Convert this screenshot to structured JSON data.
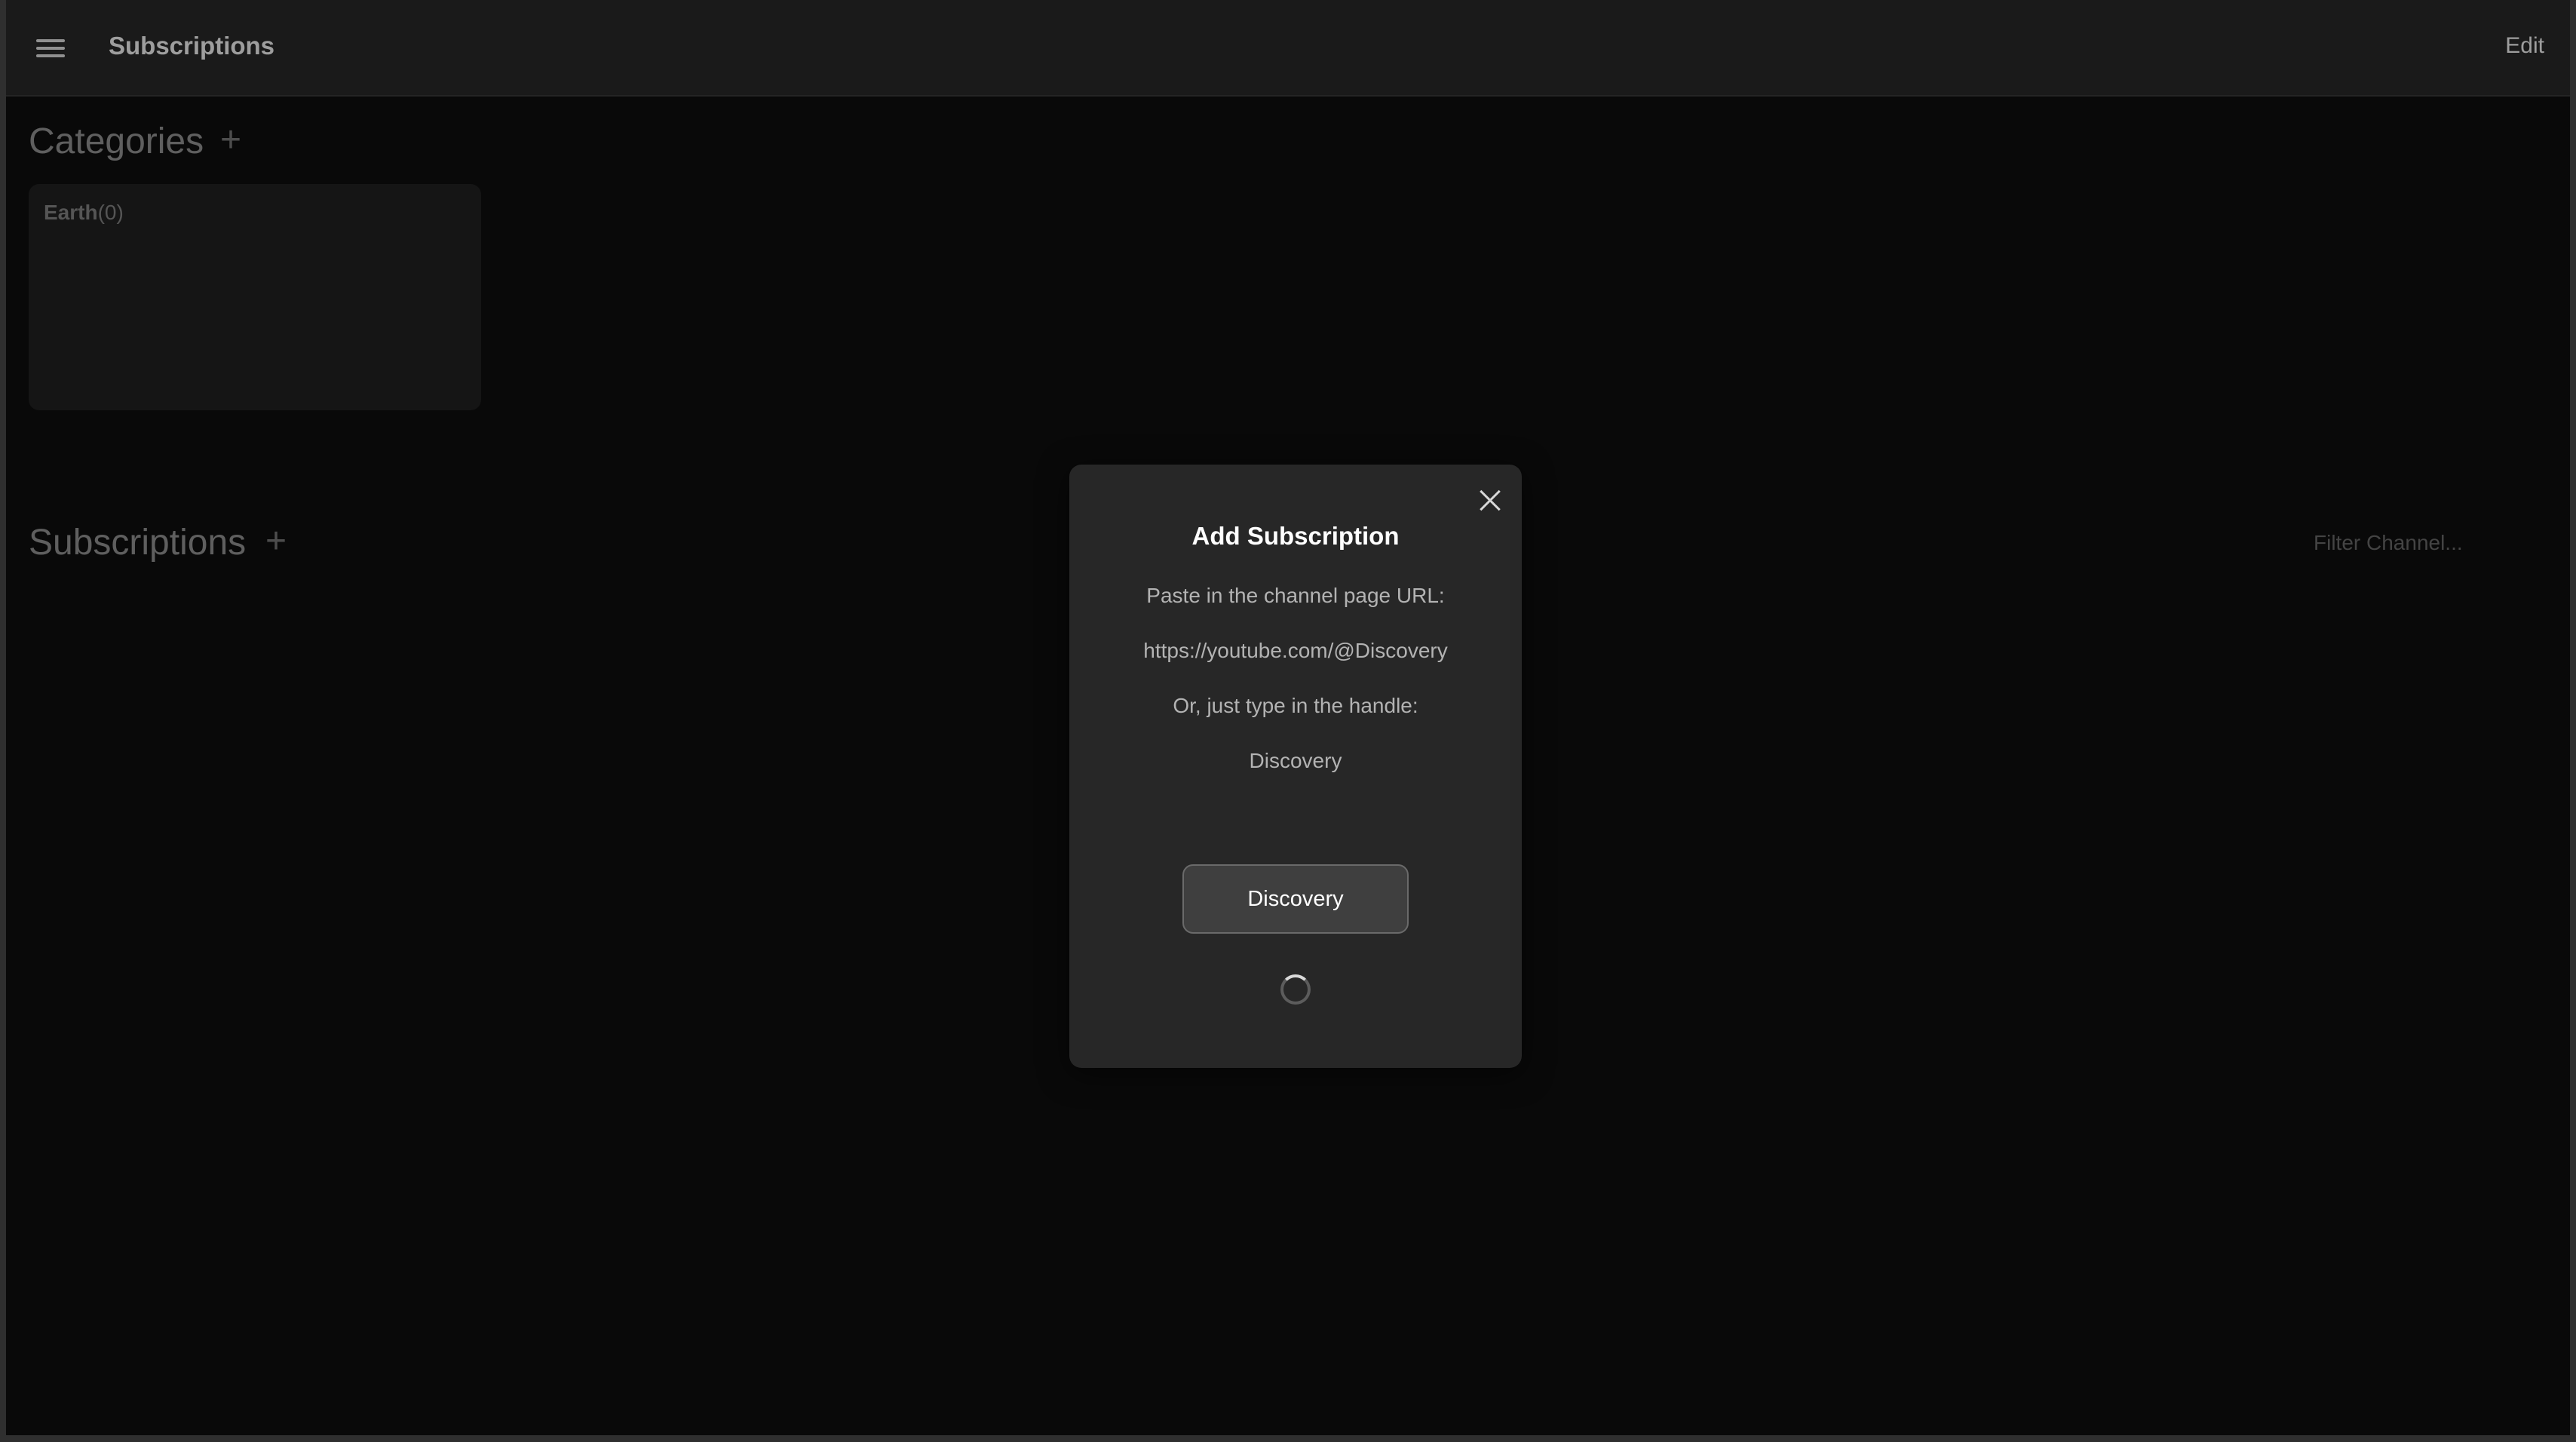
{
  "header": {
    "title": "Subscriptions",
    "edit_label": "Edit"
  },
  "categories": {
    "heading": "Categories",
    "add_symbol": "+",
    "items": [
      {
        "name": "Earth",
        "count": "(0)"
      }
    ]
  },
  "subscriptions": {
    "heading": "Subscriptions",
    "add_symbol": "+",
    "filter_placeholder": "Filter Channel..."
  },
  "modal": {
    "title": "Add Subscription",
    "instruction_url": "Paste in the channel page URL:",
    "example_url": "https://youtube.com/@Discovery",
    "instruction_handle": "Or, just type in the handle:",
    "example_handle": "Discovery",
    "button_label": "Discovery",
    "loading": true
  },
  "icons": {
    "menu": "hamburger-menu-icon",
    "close": "close-icon",
    "add": "plus-icon",
    "loading": "loading-spinner-icon"
  }
}
